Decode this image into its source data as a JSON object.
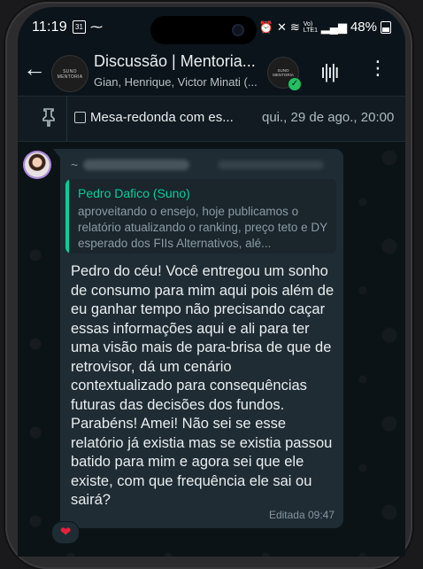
{
  "status_bar": {
    "time": "11:19",
    "calendar_day": "31",
    "battery": "48%",
    "network_label": "Vo) LTE1"
  },
  "header": {
    "title": "Discussão | Mentoria...",
    "subtitle": "Gian, Henrique, Victor Minati (...",
    "avatar_label": "SUNO MENTORIA",
    "side_avatar_label": "SUNO MENTORIA"
  },
  "pinned": {
    "event_title": "Mesa-redonda com es...",
    "event_date": "qui., 29 de ago., 20:00"
  },
  "message": {
    "sender_prefix": "~",
    "quote_author": "Pedro Dafico (Suno)",
    "quote_text": "aproveitando o ensejo, hoje publicamos o relatório atualizando o ranking, preço teto e DY esperado dos FIIs Alternativos, alé...",
    "body": "Pedro do céu! Você entregou um sonho de consumo para mim aqui pois além de eu ganhar tempo não precisando caçar essas informações aqui e ali para ter uma visão mais de para-brisa de que de retrovisor, dá um cenário contextualizado para consequências futuras das decisões dos fundos. Parabéns! Amei! Não sei se esse relatório já existia mas se existia passou batido para mim e agora sei que ele existe, com que frequência ele sai ou sairá?",
    "meta": "Editada 09:47",
    "reaction": "❤"
  },
  "colors": {
    "accent": "#06cf9c",
    "bubble": "#1f2c34",
    "background": "#0b141a"
  }
}
